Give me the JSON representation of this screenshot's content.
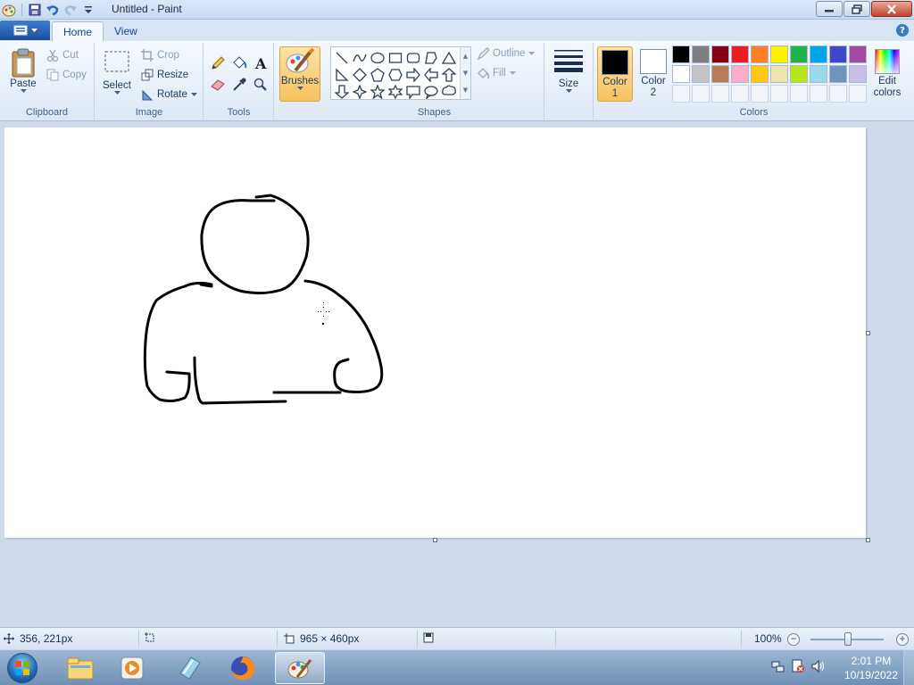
{
  "window": {
    "title": "Untitled - Paint"
  },
  "tabs": {
    "home": "Home",
    "view": "View"
  },
  "groups": {
    "clipboard": "Clipboard",
    "image": "Image",
    "tools": "Tools",
    "shapes": "Shapes",
    "colors": "Colors"
  },
  "clipboard": {
    "paste": "Paste",
    "cut": "Cut",
    "copy": "Copy"
  },
  "image": {
    "select": "Select",
    "crop": "Crop",
    "resize": "Resize",
    "rotate": "Rotate"
  },
  "brushes": {
    "label": "Brushes"
  },
  "shapes": {
    "outline": "Outline",
    "fill": "Fill"
  },
  "size": {
    "label": "Size"
  },
  "colors": {
    "color1_line1": "Color",
    "color1_line2": "1",
    "color2_line1": "Color",
    "color2_line2": "2",
    "edit_line1": "Edit",
    "edit_line2": "colors",
    "color1_value": "#000000",
    "color2_value": "#ffffff",
    "palette_row1": [
      "#000000",
      "#7f7f7f",
      "#880015",
      "#ed1c24",
      "#ff7f27",
      "#fff200",
      "#22b14c",
      "#00a2e8",
      "#3f48cc",
      "#a349a4"
    ],
    "palette_row2": [
      "#ffffff",
      "#c3c3c3",
      "#b97a57",
      "#ffaec9",
      "#ffc90e",
      "#efe4b0",
      "#b5e61d",
      "#99d9ea",
      "#7092be",
      "#c8bfe7"
    ]
  },
  "status": {
    "cursor_pos": "356, 221px",
    "selection_size": "",
    "canvas_size": "965 × 460px",
    "zoom": "100%"
  },
  "clock": {
    "time": "2:01 PM",
    "date": "10/19/2022"
  }
}
